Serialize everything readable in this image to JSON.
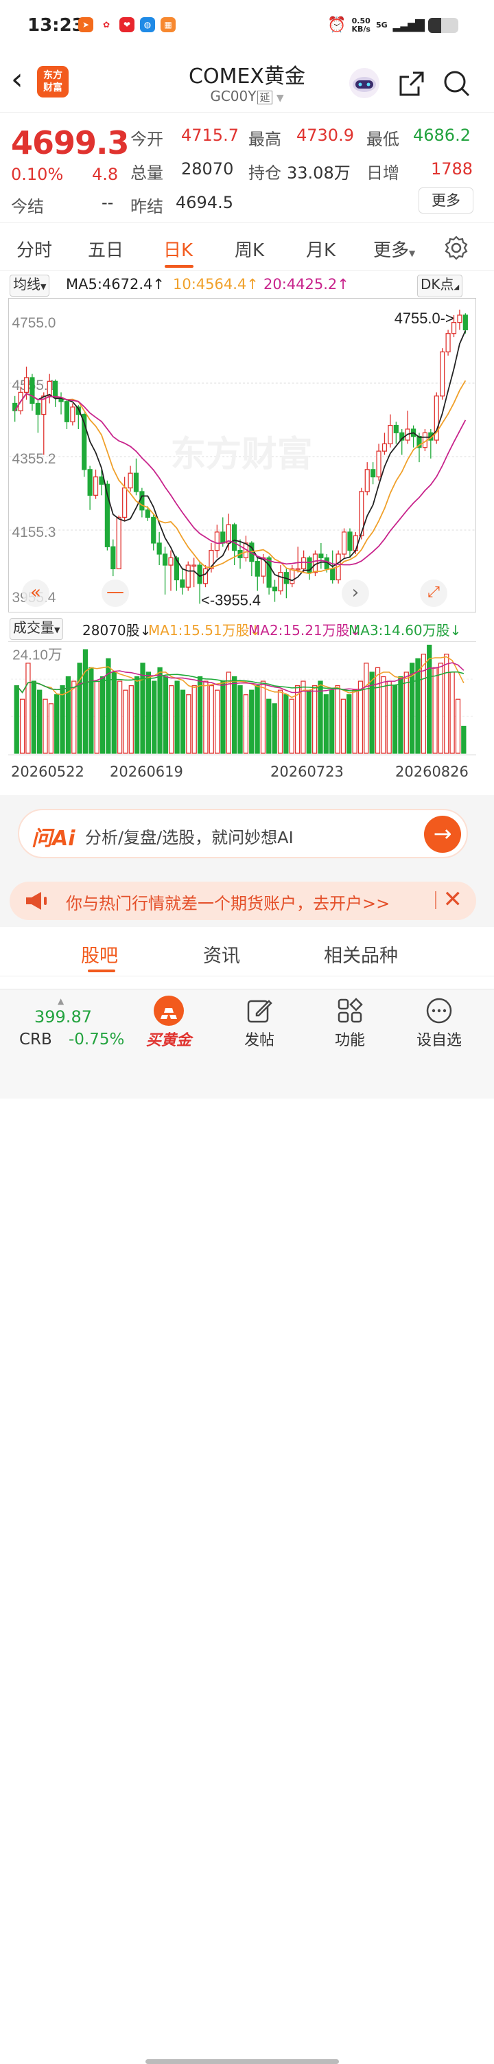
{
  "status_bar": {
    "time": "13:23",
    "app_icons": [
      "paper-plane-icon",
      "flower-icon",
      "heart-badge-icon",
      "browser-icon",
      "grid-app-icon"
    ],
    "app_colors": [
      "#f36b1c",
      "#ffffff",
      "#e8262d",
      "#1f8ae6",
      "#f7882f"
    ],
    "net_speed": "0.50",
    "net_unit": "KB/s",
    "network": "5G"
  },
  "header": {
    "logo_text": "东方\n财富",
    "title": "COMEX黄金",
    "code": "GC00Y",
    "code_tag": "延"
  },
  "quote": {
    "price": "4699.3",
    "change_pct": "0.10%",
    "change": "4.8",
    "settle_label": "今结",
    "settle_value": "--",
    "open_label": "今开",
    "open_value": "4715.7",
    "high_label": "最高",
    "high_value": "4730.9",
    "low_label": "最低",
    "low_value": "4686.2",
    "volume_label": "总量",
    "volume_value": "28070",
    "oi_label": "持仓",
    "oi_value": "33.08万",
    "daily_inc_label": "日增",
    "daily_inc_value": "1788",
    "prev_settle_label": "昨结",
    "prev_settle_value": "4694.5",
    "more_button": "更多"
  },
  "period_tabs": [
    "分时",
    "五日",
    "日K",
    "周K",
    "月K",
    "更多"
  ],
  "active_tab": 2,
  "ma_bar": {
    "selector": "均线",
    "ma5": "MA5:4672.4",
    "ma10": "10:4564.4",
    "ma20": "20:4425.2",
    "dk_button": "DK点"
  },
  "chart_colors": {
    "up": "#e0332f",
    "down": "#1faa39",
    "ma5": "#222222",
    "ma10": "#f0a02a",
    "ma20": "#c8248c"
  },
  "chart_data": {
    "type": "candlestick",
    "price_axis_ticks": [
      "4755.0",
      "4555.1",
      "4355.2",
      "4155.3",
      "3955.4"
    ],
    "ylim": [
      3955.4,
      4755.0
    ],
    "max_label": "4755.0->",
    "min_label": "<-3955.4",
    "watermark": "东方财富",
    "dates": [
      "20260522",
      "20260619",
      "20260723",
      "20260826"
    ],
    "candles": [
      [
        4500,
        4480,
        4520,
        4450
      ],
      [
        4480,
        4530,
        4545,
        4470
      ],
      [
        4530,
        4570,
        4600,
        4510
      ],
      [
        4570,
        4500,
        4580,
        4480
      ],
      [
        4500,
        4470,
        4510,
        4420
      ],
      [
        4470,
        4520,
        4530,
        4360
      ],
      [
        4520,
        4560,
        4580,
        4500
      ],
      [
        4560,
        4515,
        4565,
        4490
      ],
      [
        4515,
        4505,
        4530,
        4470
      ],
      [
        4505,
        4450,
        4510,
        4430
      ],
      [
        4450,
        4490,
        4500,
        4440
      ],
      [
        4490,
        4470,
        4495,
        4430
      ],
      [
        4470,
        4320,
        4475,
        4300
      ],
      [
        4320,
        4250,
        4330,
        4210
      ],
      [
        4250,
        4300,
        4320,
        4240
      ],
      [
        4300,
        4280,
        4320,
        4250
      ],
      [
        4280,
        4110,
        4290,
        4100
      ],
      [
        4110,
        4050,
        4130,
        4030
      ],
      [
        4050,
        4190,
        4195,
        4050
      ],
      [
        4190,
        4270,
        4300,
        4180
      ],
      [
        4270,
        4310,
        4330,
        4260
      ],
      [
        4310,
        4260,
        4350,
        4250
      ],
      [
        4260,
        4210,
        4270,
        4190
      ],
      [
        4210,
        4190,
        4220,
        4180
      ],
      [
        4190,
        4120,
        4200,
        4100
      ],
      [
        4120,
        4090,
        4150,
        4060
      ],
      [
        4090,
        4060,
        4110,
        3980
      ],
      [
        4060,
        4080,
        4100,
        3990
      ],
      [
        4080,
        4020,
        4085,
        3990
      ],
      [
        4020,
        4000,
        4050,
        3980
      ],
      [
        4000,
        4060,
        4070,
        3990
      ],
      [
        4060,
        4060,
        4080,
        4000
      ],
      [
        4060,
        4010,
        4070,
        3955
      ],
      [
        4010,
        4050,
        4060,
        4000
      ],
      [
        4050,
        4100,
        4120,
        4040
      ],
      [
        4100,
        4150,
        4170,
        4080
      ],
      [
        4150,
        4120,
        4190,
        4110
      ],
      [
        4120,
        4170,
        4200,
        4100
      ],
      [
        4170,
        4100,
        4175,
        4060
      ],
      [
        4100,
        4080,
        4130,
        4050
      ],
      [
        4080,
        4120,
        4140,
        4070
      ],
      [
        4120,
        4070,
        4125,
        4030
      ],
      [
        4070,
        4030,
        4080,
        3990
      ],
      [
        4030,
        4080,
        4090,
        4010
      ],
      [
        4080,
        4000,
        4085,
        3980
      ],
      [
        4000,
        3990,
        4020,
        3960
      ],
      [
        3990,
        4040,
        4060,
        3980
      ],
      [
        4040,
        4010,
        4050,
        3970
      ],
      [
        4010,
        4050,
        4060,
        4000
      ],
      [
        4050,
        4050,
        4110,
        4040
      ],
      [
        4050,
        4080,
        4100,
        4040
      ],
      [
        4080,
        4040,
        4085,
        4020
      ],
      [
        4040,
        4090,
        4100,
        4030
      ],
      [
        4090,
        4080,
        4120,
        4050
      ],
      [
        4080,
        4050,
        4090,
        4040
      ],
      [
        4050,
        4020,
        4100,
        4010
      ],
      [
        4020,
        4090,
        4100,
        4010
      ],
      [
        4090,
        4150,
        4160,
        4080
      ],
      [
        4150,
        4100,
        4160,
        4080
      ],
      [
        4100,
        4140,
        4150,
        4090
      ],
      [
        4140,
        4260,
        4270,
        4130
      ],
      [
        4260,
        4320,
        4340,
        4250
      ],
      [
        4320,
        4300,
        4340,
        4280
      ],
      [
        4300,
        4370,
        4390,
        4290
      ],
      [
        4370,
        4390,
        4420,
        4360
      ],
      [
        4390,
        4440,
        4470,
        4380
      ],
      [
        4440,
        4420,
        4450,
        4390
      ],
      [
        4420,
        4400,
        4430,
        4360
      ],
      [
        4400,
        4430,
        4480,
        4390
      ],
      [
        4430,
        4410,
        4440,
        4380
      ],
      [
        4410,
        4380,
        4420,
        4340
      ],
      [
        4380,
        4420,
        4430,
        4370
      ],
      [
        4420,
        4400,
        4430,
        4350
      ],
      [
        4400,
        4520,
        4530,
        4390
      ],
      [
        4520,
        4640,
        4650,
        4510
      ],
      [
        4640,
        4690,
        4700,
        4630
      ],
      [
        4690,
        4720,
        4740,
        4680
      ],
      [
        4720,
        4740,
        4755,
        4700
      ],
      [
        4740,
        4700,
        4745,
        4690
      ]
    ]
  },
  "volume_bar": {
    "selector": "成交量",
    "vol": "28070股",
    "ma1": "MA1:15.51万股",
    "ma2": "MA2:15.21万股",
    "ma3": "MA3:14.60万股",
    "max_label": "24.10万",
    "values": [
      150,
      120,
      200,
      160,
      140,
      120,
      110,
      130,
      150,
      170,
      160,
      200,
      230,
      190,
      160,
      170,
      210,
      180,
      160,
      140,
      150,
      170,
      200,
      180,
      160,
      190,
      170,
      150,
      160,
      140,
      130,
      150,
      170,
      160,
      150,
      140,
      160,
      180,
      170,
      150,
      130,
      140,
      150,
      160,
      120,
      110,
      140,
      130,
      120,
      150,
      160,
      140,
      150,
      160,
      130,
      140,
      150,
      120,
      130,
      140,
      160,
      200,
      180,
      190,
      170,
      160,
      150,
      170,
      180,
      200,
      210,
      220,
      240,
      190,
      200,
      220,
      180,
      120,
      60
    ]
  },
  "ai_box": {
    "logo": "问Ai",
    "placeholder": "分析/复盘/选股，就问妙想AI"
  },
  "promo": {
    "text": "你与热门行情就差一个期货账户，去开户>>"
  },
  "bottom_tabs": [
    "股吧",
    "资讯",
    "相关品种"
  ],
  "nav": {
    "crb_value": "399.87",
    "crb_label": "CRB",
    "crb_change": "-0.75%",
    "items": [
      "买黄金",
      "发帖",
      "功能",
      "设自选"
    ]
  }
}
